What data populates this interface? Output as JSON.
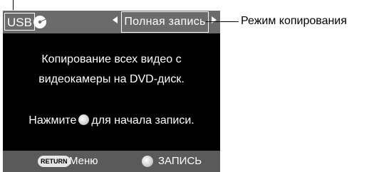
{
  "topbar": {
    "source_label": "USB",
    "media_icon": "dvd-disc-icon",
    "mode_label": "Полная запись"
  },
  "message": {
    "line1": "Копирование всех видео с",
    "line2": "видеокамеры на DVD-диск.",
    "line3_before": "Нажмите",
    "line3_after": "для начала записи."
  },
  "bottombar": {
    "return_key": "RETURN",
    "menu_label": "Меню",
    "rec_label": "ЗАПИСЬ"
  },
  "annotation": {
    "callout": "Режим копирования"
  }
}
